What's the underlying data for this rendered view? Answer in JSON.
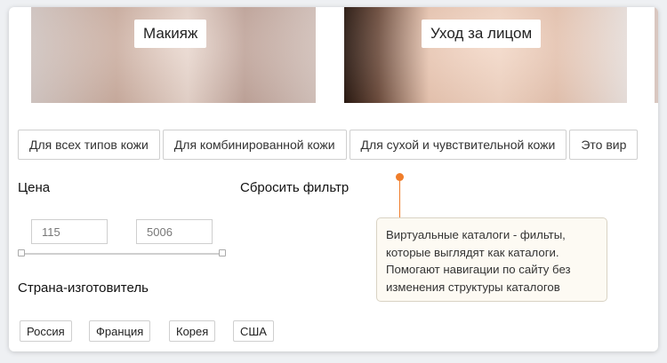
{
  "banners": [
    {
      "label": "Макияж"
    },
    {
      "label": "Уход за лицом"
    }
  ],
  "filter_tags": [
    "Для всех типов кожи",
    "Для комбинированной кожи",
    "Для сухой и чувствительной кожи",
    "Это вир"
  ],
  "price": {
    "title": "Цена",
    "min_value": "115",
    "max_value": "5006"
  },
  "reset_label": "Сбросить фильтр",
  "country": {
    "title": "Страна-изготовитель",
    "options": [
      "Россия",
      "Франция",
      "Корея",
      "США"
    ]
  },
  "tooltip": {
    "text": "Виртуальные каталоги - фильты, которые выглядят как каталоги. Помогают навигации по сайту без изменения структуры каталогов"
  },
  "colors": {
    "accent": "#f07d2a",
    "tooltip_bg": "#fdfaf3"
  }
}
